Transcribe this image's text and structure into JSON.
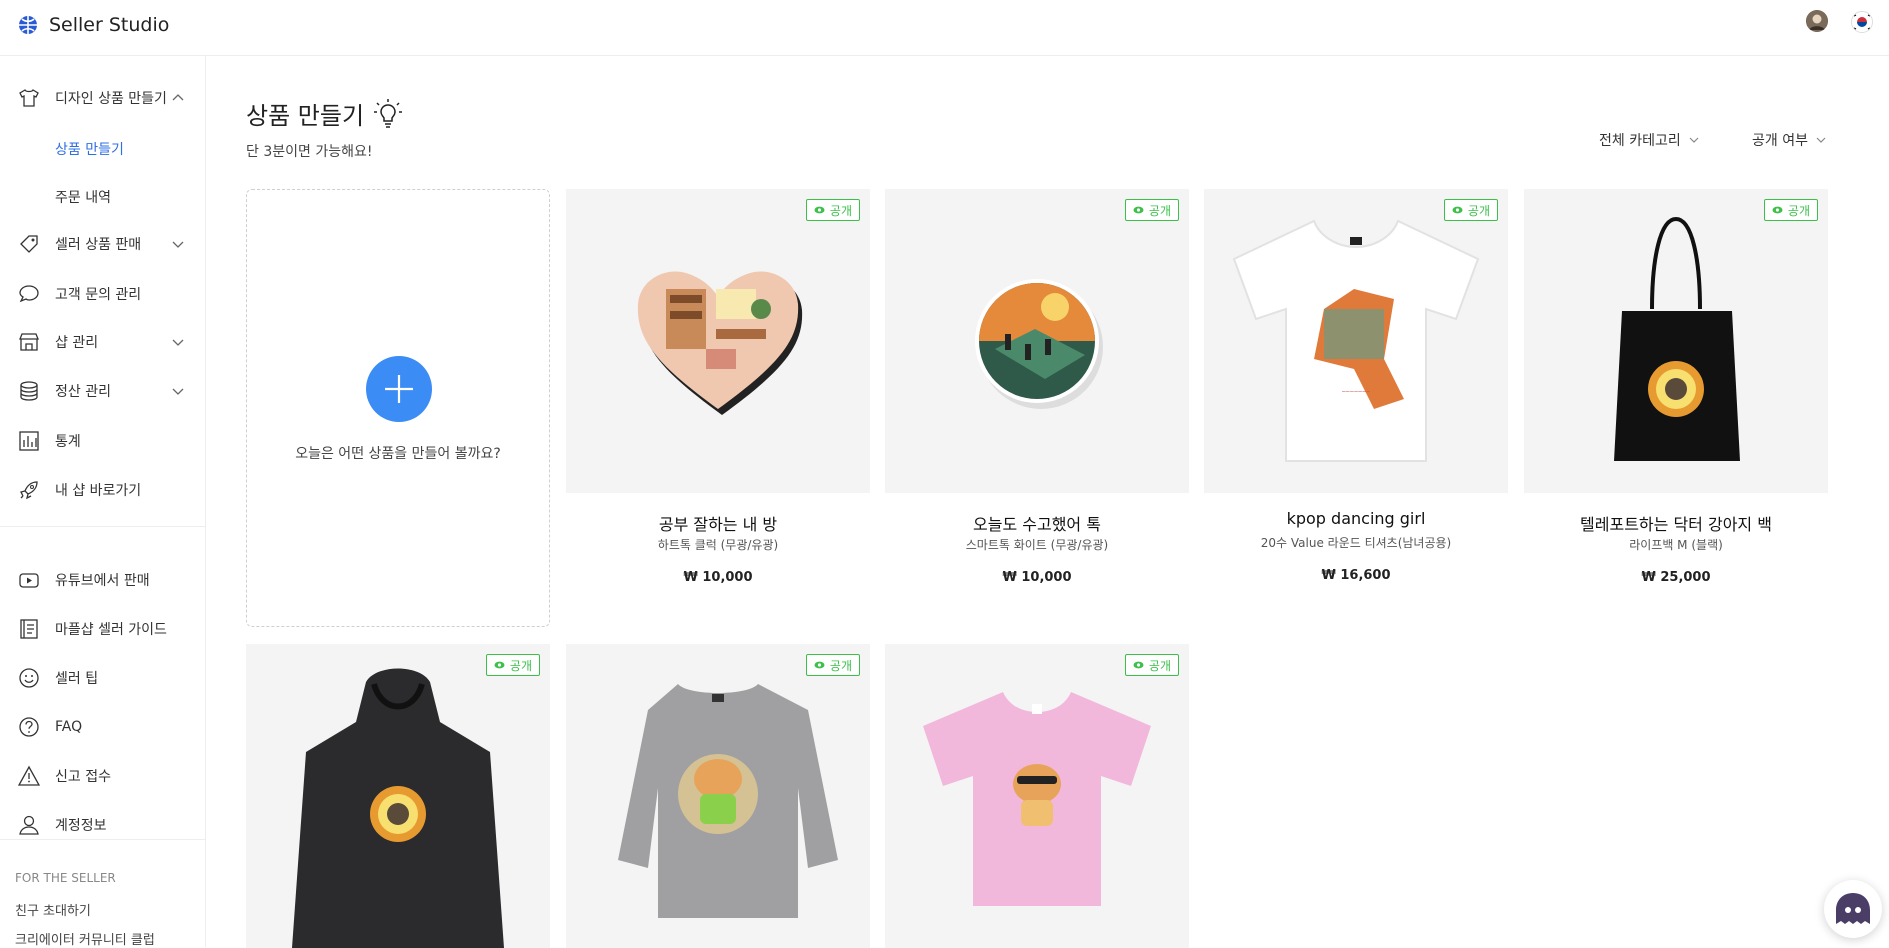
{
  "app": {
    "title": "Seller Studio"
  },
  "sidebar": {
    "items": [
      {
        "label": "디자인 상품 만들기",
        "icon": "tshirt-icon"
      },
      {
        "label": "셀러 상품 판매",
        "icon": "tag-icon"
      },
      {
        "label": "고객 문의 관리",
        "icon": "chat-bubble-icon"
      },
      {
        "label": "샵 관리",
        "icon": "store-icon"
      },
      {
        "label": "정산 관리",
        "icon": "coins-icon"
      },
      {
        "label": "통계",
        "icon": "bar-chart-icon"
      },
      {
        "label": "내 샵 바로가기",
        "icon": "rocket-icon"
      },
      {
        "label": "유튜브에서 판매",
        "icon": "youtube-icon"
      },
      {
        "label": "마플샵 셀러 가이드",
        "icon": "book-icon"
      },
      {
        "label": "셀러 팁",
        "icon": "smile-icon"
      },
      {
        "label": "FAQ",
        "icon": "question-icon"
      },
      {
        "label": "신고 접수",
        "icon": "warning-icon"
      },
      {
        "label": "계정정보",
        "icon": "user-icon"
      }
    ],
    "sub_items": [
      {
        "label": "상품 만들기",
        "active": true
      },
      {
        "label": "주문 내역",
        "active": false
      }
    ],
    "section_title": "FOR THE SELLER",
    "footer_links": [
      "친구 초대하기",
      "크리에이터 커뮤니티 클럽"
    ]
  },
  "main": {
    "title": "상품 만들기",
    "subtitle": "단 3분이면 가능해요!",
    "filters": {
      "category": "전체 카테고리",
      "visibility": "공개 여부"
    },
    "create_card": {
      "text": "오늘은 어떤 상품을 만들어 볼까요?"
    },
    "badge_label": "공개",
    "products": [
      {
        "name": "공부 잘하는 내 방",
        "type": "하트톡 클럭 (무광/유광)",
        "price": "₩ 10,000"
      },
      {
        "name": "오늘도 수고했어 톡",
        "type": "스마트톡 화이트 (무광/유광)",
        "price": "₩ 10,000"
      },
      {
        "name": "kpop dancing girl",
        "type": "20수 Value 라운드 티셔츠(남녀공용)",
        "price": "₩ 16,600"
      },
      {
        "name": "텔레포트하는 닥터 강아지 백",
        "type": "라이프백 M (블랙)",
        "price": "₩ 25,000"
      },
      {
        "name": "",
        "type": "",
        "price": ""
      },
      {
        "name": "",
        "type": "",
        "price": ""
      },
      {
        "name": "",
        "type": "",
        "price": ""
      }
    ]
  },
  "colors": {
    "accent": "#2f6fe4",
    "plus_button": "#3b8cf5",
    "badge_green": "#3cc04a"
  }
}
